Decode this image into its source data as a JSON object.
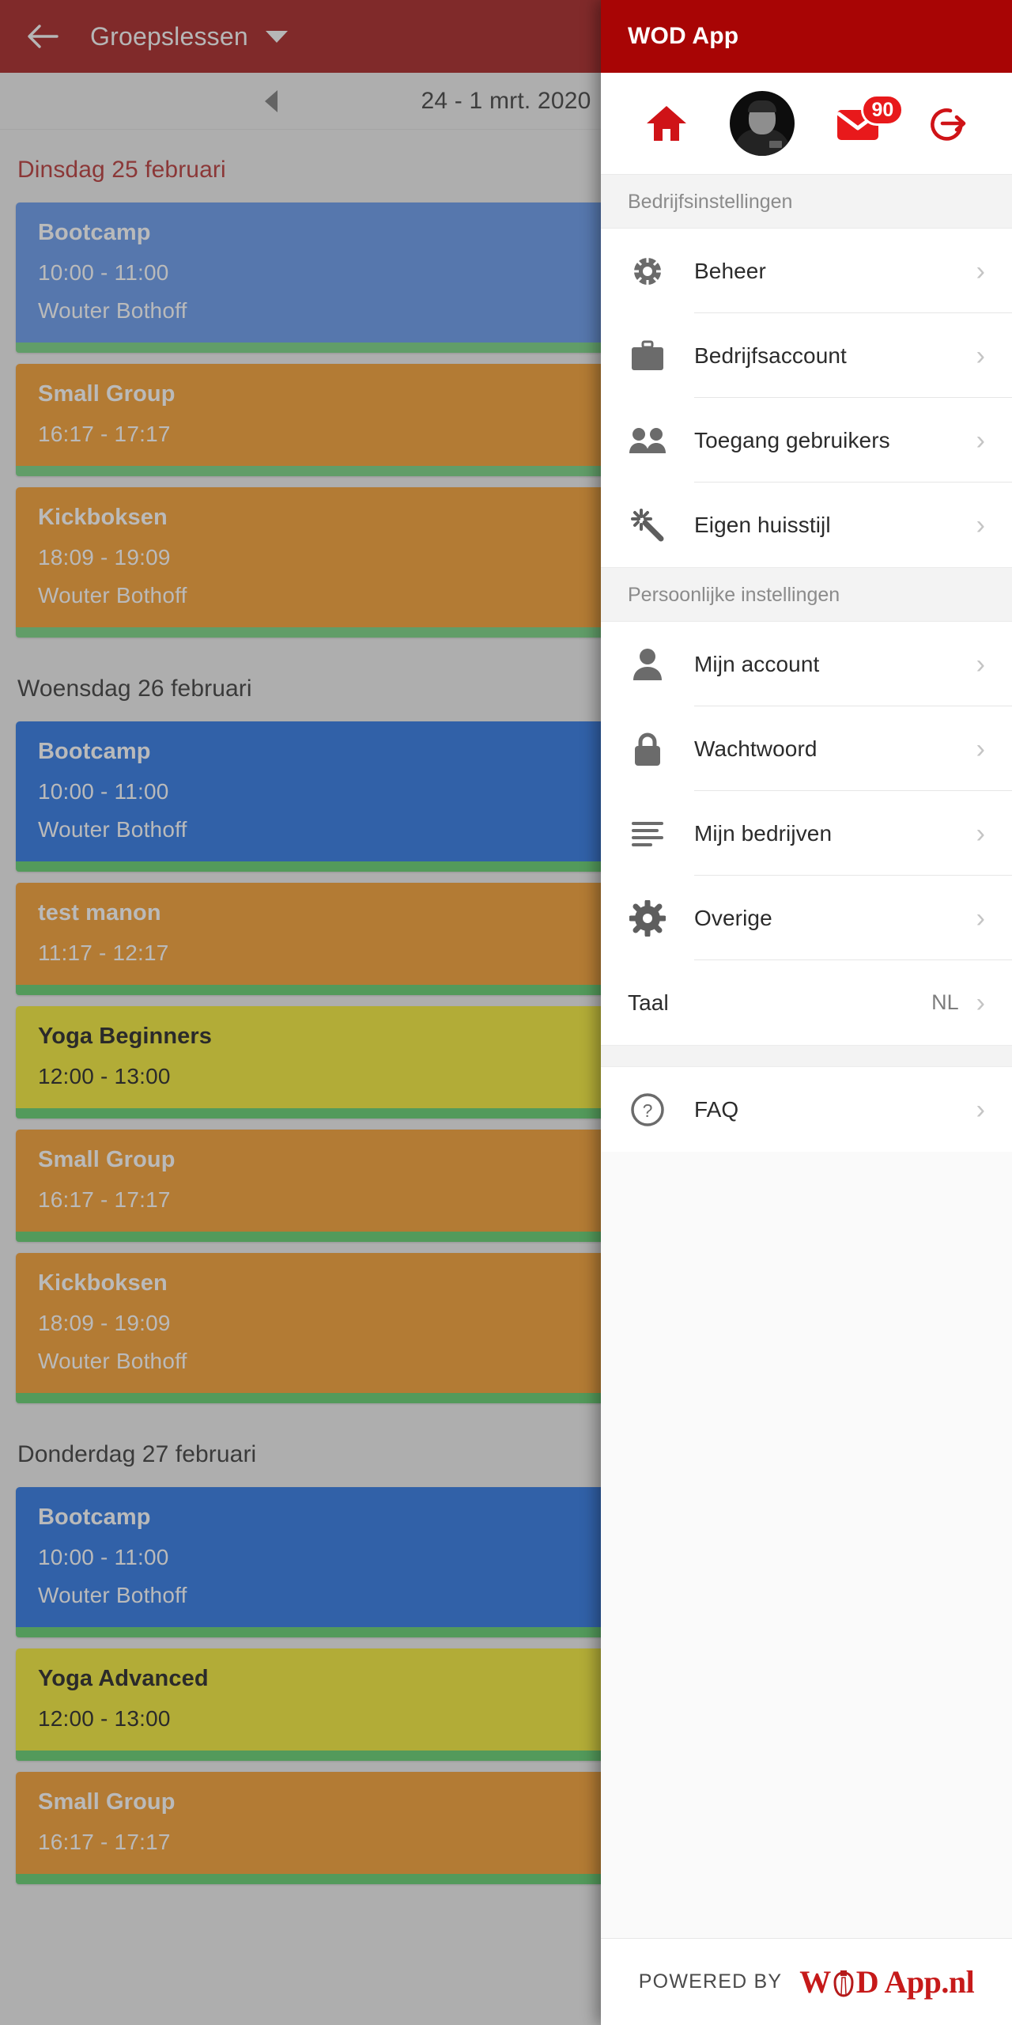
{
  "calendar": {
    "appbar": {
      "title": "Groepslessen",
      "back_icon": "arrow-left-icon",
      "dropdown_icon": "chevron-down-icon"
    },
    "week": {
      "prev_icon": "triangle-left-icon",
      "label": "24 - 1 mrt. 2020"
    },
    "days": [
      {
        "label": "Dinsdag 25 februari",
        "highlight": true,
        "events": [
          {
            "title": "Bootcamp",
            "time": "10:00 - 11:00",
            "coach": "Wouter Bothoff",
            "color": "#3f6fbc",
            "text": "light",
            "bar": "#4fa55a"
          },
          {
            "title": "Small Group",
            "time": "16:17 - 17:17",
            "coach": "",
            "color": "#c5740f",
            "text": "light",
            "bar": "#4fa55a"
          },
          {
            "title": "Kickboksen",
            "time": "18:09 - 19:09",
            "coach": "Wouter Bothoff",
            "color": "#c5740f",
            "text": "light",
            "bar": "#4fa55a"
          }
        ]
      },
      {
        "label": "Woensdag 26 februari",
        "highlight": false,
        "events": [
          {
            "title": "Bootcamp",
            "time": "10:00 - 11:00",
            "coach": "Wouter Bothoff",
            "color": "#0b4fb5",
            "text": "light",
            "bar": "#3ba147"
          },
          {
            "title": "test manon",
            "time": "11:17 - 12:17",
            "coach": "",
            "color": "#c5740f",
            "text": "light",
            "bar": "#3ba147"
          },
          {
            "title": "Yoga Beginners",
            "time": "12:00 - 13:00",
            "coach": "",
            "color": "#c3bb14",
            "text": "dark",
            "bar": "#3ba147"
          },
          {
            "title": "Small Group",
            "time": "16:17 - 17:17",
            "coach": "",
            "color": "#c5740f",
            "text": "light",
            "bar": "#3ba147"
          },
          {
            "title": "Kickboksen",
            "time": "18:09 - 19:09",
            "coach": "Wouter Bothoff",
            "color": "#c5740f",
            "text": "light",
            "bar": "#3ba147"
          }
        ]
      },
      {
        "label": "Donderdag 27 februari",
        "highlight": false,
        "events": [
          {
            "title": "Bootcamp",
            "time": "10:00 - 11:00",
            "coach": "Wouter Bothoff",
            "color": "#0b4fb5",
            "text": "light",
            "bar": "#3ba147"
          },
          {
            "title": "Yoga Advanced",
            "time": "12:00 - 13:00",
            "coach": "",
            "color": "#c3bb14",
            "text": "dark",
            "bar": "#3ba147"
          },
          {
            "title": "Small Group",
            "time": "16:17 - 17:17",
            "coach": "",
            "color": "#c5740f",
            "text": "light",
            "bar": "#3ba147"
          }
        ]
      }
    ]
  },
  "drawer": {
    "title": "WOD App",
    "quick_icons": [
      {
        "name": "home-icon",
        "label": "Home"
      },
      {
        "name": "avatar",
        "label": "Profiel"
      },
      {
        "name": "mail-icon",
        "label": "Berichten",
        "badge": "90"
      },
      {
        "name": "logout-icon",
        "label": "Uitloggen"
      }
    ],
    "sections": [
      {
        "header": "Bedrijfsinstellingen",
        "items": [
          {
            "label": "Beheer",
            "icon": "gear-icon",
            "chevron": "›"
          },
          {
            "label": "Bedrijfsaccount",
            "icon": "briefcase-icon",
            "chevron": "›"
          },
          {
            "label": "Toegang gebruikers",
            "icon": "people-icon",
            "chevron": "›"
          },
          {
            "label": "Eigen huisstijl",
            "icon": "magic-wand-icon",
            "chevron": "›"
          }
        ]
      },
      {
        "header": "Persoonlijke instellingen",
        "items": [
          {
            "label": "Mijn account",
            "icon": "person-icon",
            "chevron": "›"
          },
          {
            "label": "Wachtwoord",
            "icon": "lock-icon",
            "chevron": "›"
          },
          {
            "label": "Mijn bedrijven",
            "icon": "list-icon",
            "chevron": "›"
          },
          {
            "label": "Overige",
            "icon": "settings-icon",
            "chevron": "›"
          },
          {
            "label": "Taal",
            "icon": "",
            "value": "NL",
            "chevron": "›"
          }
        ]
      },
      {
        "header": "",
        "items": [
          {
            "label": "FAQ",
            "icon": "help-circle-icon",
            "chevron": "›"
          }
        ]
      }
    ],
    "footer": {
      "powered_by": "POWERED BY",
      "logo_left": "W",
      "logo_right": "D App.nl"
    }
  }
}
